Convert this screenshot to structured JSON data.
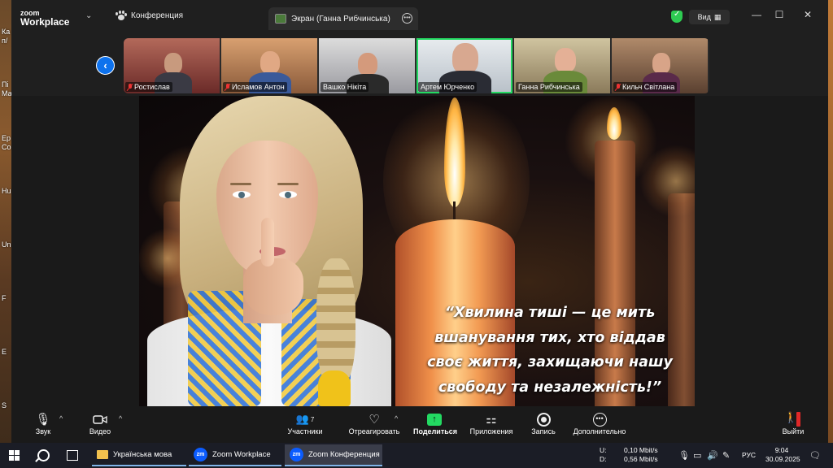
{
  "desktop": {
    "icon_labels": [
      "Ка",
      "п/",
      "Пі",
      "Ма",
      "Ер",
      "Co",
      "Hu",
      "Un",
      "F",
      "Е",
      "S"
    ]
  },
  "titlebar": {
    "logo_line1": "zoom",
    "logo_line2": "Workplace",
    "conference_tab": "Конференция",
    "screen_tab": "Экран (Ганна Рибчинська)",
    "view_label": "Вид",
    "minimize": "—",
    "maximize": "☐",
    "close": "✕"
  },
  "participants": [
    {
      "name": "Ростислав",
      "muted": true
    },
    {
      "name": "Исламов Антон",
      "muted": true
    },
    {
      "name": "Вашко Нікіта",
      "muted": false
    },
    {
      "name": "Артем Юрченко",
      "muted": false,
      "active_speaker": true
    },
    {
      "name": "Ганна Рибчинська",
      "muted": false
    },
    {
      "name": "Кильч Світлана",
      "muted": true
    }
  ],
  "shared_content": {
    "quote_lines": [
      "“Хвилина тиші — це мить",
      "вшанування тих, хто віддав",
      "своє життя, захищаючи нашу",
      "свободу та незалежність!”"
    ]
  },
  "toolbar": {
    "audio": "Звук",
    "video": "Видео",
    "participants": "Участники",
    "participants_count": "7",
    "react": "Отреагировать",
    "share": "Поделиться",
    "apps": "Приложения",
    "record": "Запись",
    "more": "Дополнительно",
    "leave": "Выйти"
  },
  "taskbar": {
    "apps": [
      {
        "label": "Українська мова",
        "icon": "folder-icon",
        "active": false
      },
      {
        "label": "Zoom Workplace",
        "icon": "zoom-icon",
        "active": false
      },
      {
        "label": "Zoom Конференция",
        "icon": "zoom-icon",
        "active": true
      }
    ],
    "net_up_label": "U:",
    "net_down_label": "D:",
    "net_up": "0,10 Mbit/s",
    "net_down": "0,56 Mbit/s",
    "language": "РУС",
    "time": "9:04",
    "date": "30.09.2025"
  },
  "colors": {
    "zoom_blue": "#0e72ed",
    "active_green": "#23d962",
    "muted_red": "#e33333"
  }
}
